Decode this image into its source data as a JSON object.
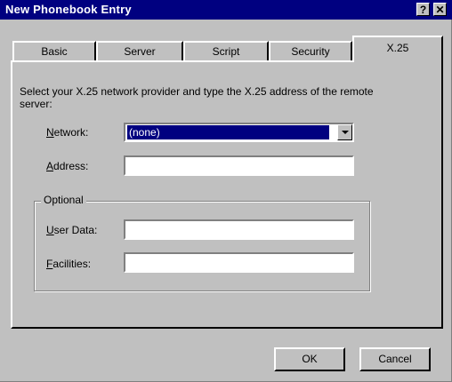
{
  "window": {
    "title": "New Phonebook Entry",
    "help_button": "?",
    "close_button": "✕"
  },
  "tabs": [
    {
      "label": "Basic"
    },
    {
      "label": "Server"
    },
    {
      "label": "Script"
    },
    {
      "label": "Security"
    },
    {
      "label": "X.25"
    }
  ],
  "active_tab": "X.25",
  "x25": {
    "description": "Select your X.25 network provider and type the X.25 address of the remote server:",
    "network": {
      "label_underlined": "N",
      "label_rest": "etwork:",
      "selected_value": "(none)"
    },
    "address": {
      "label_underlined": "A",
      "label_rest": "ddress:",
      "value": ""
    },
    "optional_group": {
      "legend": "Optional",
      "user_data": {
        "label_underlined": "U",
        "label_rest": "ser Data:",
        "value": ""
      },
      "facilities": {
        "label_underlined": "F",
        "label_rest": "acilities:",
        "value": ""
      }
    }
  },
  "buttons": {
    "ok": "OK",
    "cancel": "Cancel"
  },
  "colors": {
    "titlebar": "#000080",
    "face": "#c0c0c0",
    "selection": "#000080"
  }
}
